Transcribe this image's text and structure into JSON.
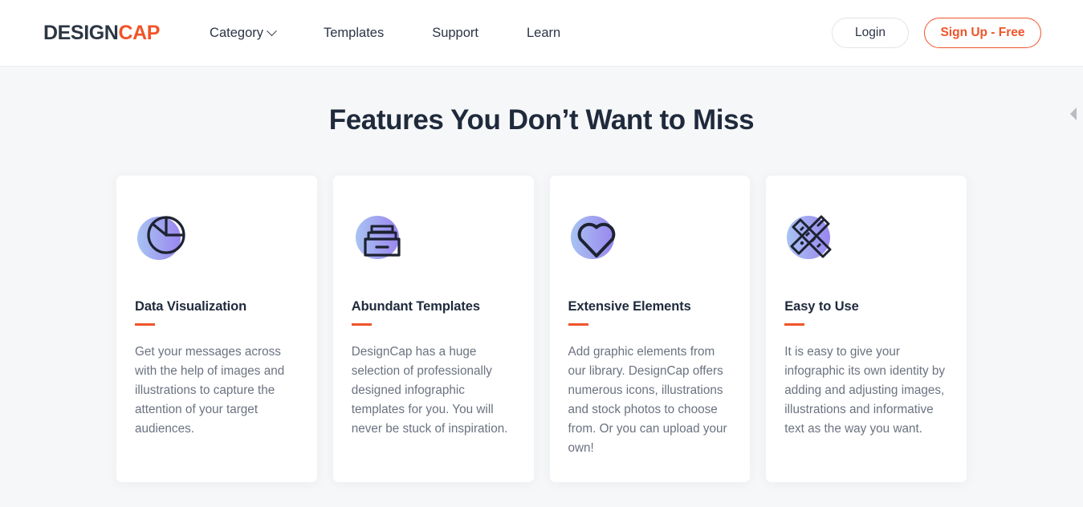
{
  "header": {
    "logo": {
      "part1": "DESIGN",
      "part2": "CAP",
      "accent_color": "#f0542a",
      "dark_color": "#2d3643"
    },
    "nav": [
      {
        "label": "Category",
        "has_dropdown": true,
        "icon": "chevron-down-icon"
      },
      {
        "label": "Templates",
        "has_dropdown": false
      },
      {
        "label": "Support",
        "has_dropdown": false
      },
      {
        "label": "Learn",
        "has_dropdown": false
      }
    ],
    "login_label": "Login",
    "signup_label": "Sign Up - Free"
  },
  "main": {
    "title": "Features You Don’t Want to Miss",
    "cards": [
      {
        "icon": "pie-chart-icon",
        "title": "Data Visualization",
        "desc": "Get your messages across with the help of images and illustrations to capture the attention of your target audiences."
      },
      {
        "icon": "file-drawer-icon",
        "title": "Abundant Templates",
        "desc": "DesignCap has a huge selection of professionally designed infographic templates for you. You will never be stuck of inspiration."
      },
      {
        "icon": "heart-icon",
        "title": "Extensive Elements",
        "desc": "Add graphic elements from our library. DesignCap offers numerous icons, illustrations and stock photos to choose from. Or you can upload your own!"
      },
      {
        "icon": "pencil-ruler-icon",
        "title": "Easy to Use",
        "desc": "It is easy to give your infographic its own identity by adding and adjusting images, illustrations and informative text as the way you want."
      }
    ],
    "edge_handle_icon": "triangle-left-icon"
  },
  "colors": {
    "accent_orange": "#f0542a",
    "page_background": "#f6f7f9",
    "card_background": "#ffffff",
    "heading": "#1f2a3c",
    "body_text": "#6b7280",
    "icon_gradient_start": "#a8c0f0",
    "icon_gradient_end": "#9a86ef",
    "icon_stroke": "#1d2330"
  }
}
